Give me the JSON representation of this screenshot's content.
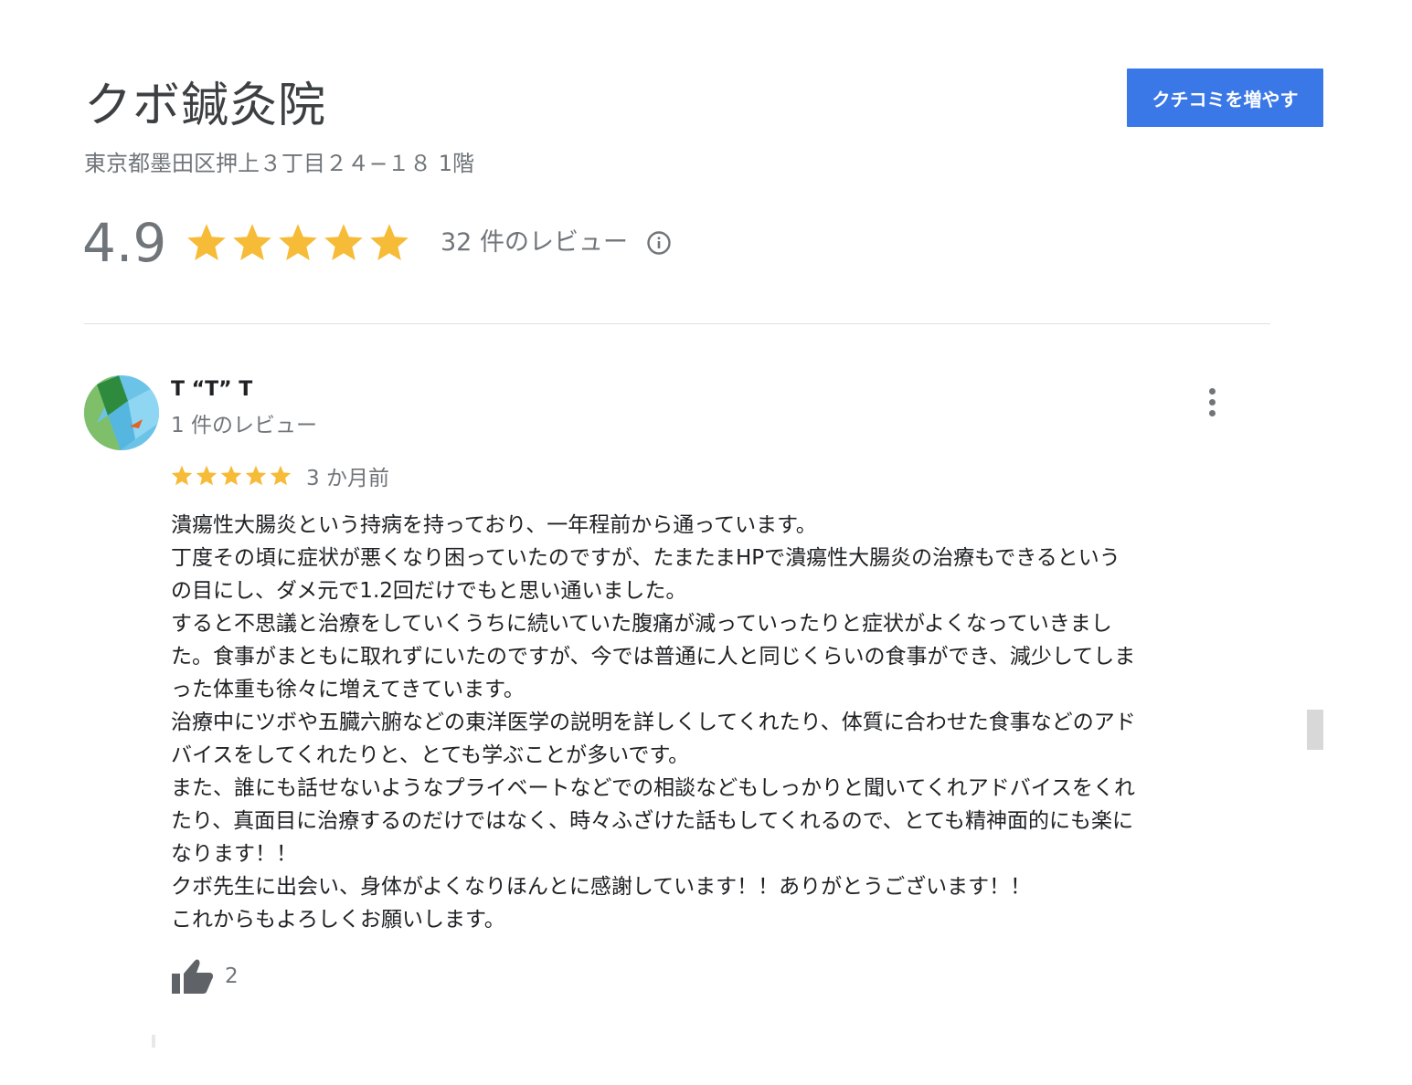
{
  "place": {
    "name": "クボ鍼灸院",
    "address": "東京都墨田区押上３丁目２４−１８ 1階"
  },
  "actions": {
    "add_review_label": "クチコミを増やす"
  },
  "summary": {
    "score": "4.9",
    "stars": 5,
    "review_count_label": "32 件のレビュー"
  },
  "review": {
    "author": "T “T” T",
    "author_reviews": "1 件のレビュー",
    "stars": 5,
    "date": "3 か月前",
    "lines": [
      "潰瘍性大腸炎という持病を持っており、一年程前から通っています。",
      "丁度その頃に症状が悪くなり困っていたのですが、たまたまHPで潰瘍性大腸炎の治療もできるという",
      "の目にし、ダメ元で1.2回だけでもと思い通いました。",
      "すると不思議と治療をしていくうちに続いていた腹痛が減っていったりと症状がよくなっていきまし",
      "た。食事がまともに取れずにいたのですが、今では普通に人と同じくらいの食事ができ、減少してしま",
      "った体重も徐々に増えてきています。",
      "治療中にツボや五臓六腑などの東洋医学の説明を詳しくしてくれたり、体質に合わせた食事などのアド",
      "バイスをしてくれたりと、とても学ぶことが多いです。",
      "また、誰にも話せないようなプライベートなどでの相談などもしっかりと聞いてくれアドバイスをくれ",
      "たり、真面目に治療するのだけではなく、時々ふざけた話もしてくれるので、とても精神面的にも楽に",
      "なります！！",
      "クボ先生に出会い、身体がよくなりほんとに感謝しています！！ありがとうございます！！",
      "これからもよろしくお願いします。"
    ],
    "likes": "2"
  },
  "colors": {
    "star": "#f6bb37",
    "button": "#3b78e7",
    "secondary_text": "#70757a"
  },
  "icons": {
    "info": "info-icon",
    "more": "more-vert-icon",
    "like": "thumb-up-icon",
    "star": "star-icon"
  }
}
